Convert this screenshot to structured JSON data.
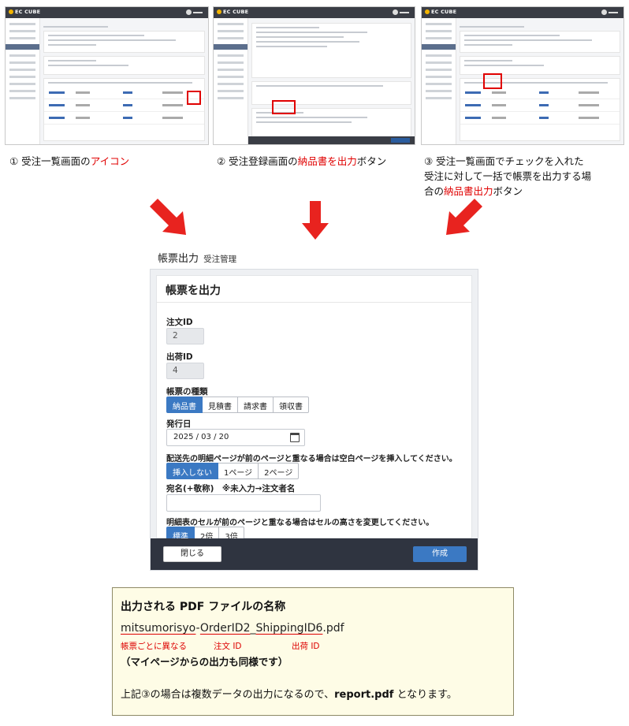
{
  "thumbnails": [
    {
      "logo": "EC CUBE",
      "screen": "受注一覧",
      "caption_pre": "① 受注一覧画面の",
      "caption_red": "アイコン",
      "caption_post": ""
    },
    {
      "logo": "EC CUBE",
      "screen": "受注登録",
      "caption_pre": "② 受注登録画面の",
      "caption_red": "納品書を出力",
      "caption_post": "ボタン"
    },
    {
      "logo": "EC CUBE",
      "screen": "受注一覧",
      "caption_line1": "③ 受注一覧画面でチェックを入れた",
      "caption_line2": "受注に対して一括で帳票を出力する場",
      "caption_line3_pre": "合の",
      "caption_line3_red": "納品書出力",
      "caption_line3_post": "ボタン"
    }
  ],
  "form": {
    "page_title": "帳票出力",
    "page_subtitle": "受注管理",
    "card_title": "帳票を出力",
    "order_id_label": "注文ID",
    "order_id_value": "2",
    "shipping_id_label": "出荷ID",
    "shipping_id_value": "4",
    "type_label": "帳票の種類",
    "types": [
      "納品書",
      "見積書",
      "請求書",
      "領収書"
    ],
    "types_selected": "納品書",
    "issue_date_label": "発行日",
    "issue_date_value": "2025 / 03 / 20",
    "blank_page_label": "配送先の明細ページが前のページと重なる場合は空白ページを挿入してください。",
    "blank_page_options": [
      "挿入しない",
      "1ページ",
      "2ページ"
    ],
    "blank_page_selected": "挿入しない",
    "addressee_label": "宛名(+敬称)　※未入力→注文者名",
    "addressee_value": "",
    "cell_height_label": "明細表のセルが前のページと重なる場合はセルの高さを変更してください。",
    "cell_height_options": [
      "標準",
      "2倍",
      "3倍"
    ],
    "cell_height_selected": "標準",
    "close_button": "閉じる",
    "create_button": "作成"
  },
  "note": {
    "title": "出力される PDF ファイルの名称",
    "file_part1": "mitsumorisyo",
    "file_sep1": "-",
    "file_part2": "OrderID2",
    "file_sep2": "_",
    "file_part3": "ShippingID6",
    "file_ext": ".pdf",
    "annot1": "帳票ごとに異なる",
    "annot2": "注文 ID",
    "annot3": "出荷 ID",
    "mypage_note": "（マイページからの出力も同様です）",
    "body_pre": "上記③の場合は複数データの出力になるので、",
    "body_bold": "report.pdf",
    "body_post": " となります。"
  },
  "colors": {
    "accent": "#3b79c3",
    "highlight": "#e00000",
    "arrow": "#e8231f",
    "footer": "#2f3440",
    "note_bg": "#fefce6"
  }
}
